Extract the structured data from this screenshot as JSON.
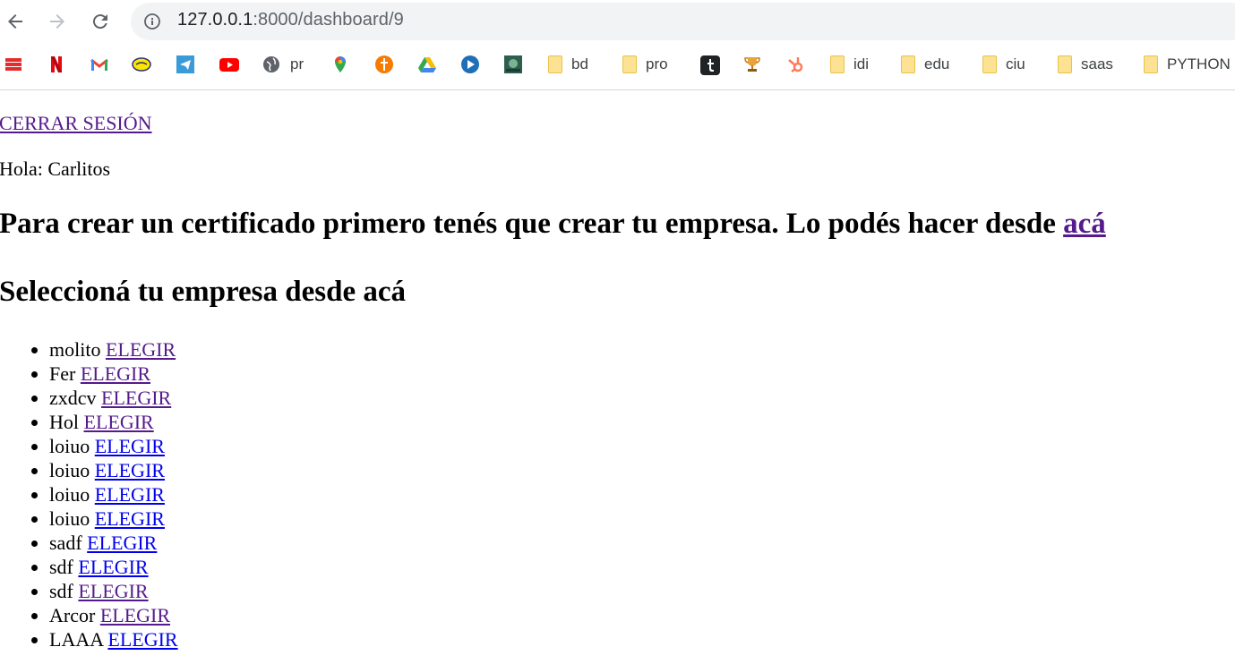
{
  "browser": {
    "url_host": "127.0.0.1",
    "url_path": ":8000/dashboard/9",
    "bookmarks": [
      {
        "icon": "espn-icon",
        "label": ""
      },
      {
        "icon": "netflix-icon",
        "label": ""
      },
      {
        "icon": "gmail-icon",
        "label": ""
      },
      {
        "icon": "mercadolibre-icon",
        "label": ""
      },
      {
        "icon": "telegram-icon",
        "label": ""
      },
      {
        "icon": "youtube-icon",
        "label": ""
      },
      {
        "icon": "globe-icon",
        "label": "pr"
      },
      {
        "icon": "maps-icon",
        "label": ""
      },
      {
        "icon": "cross-icon",
        "label": ""
      },
      {
        "icon": "drive-icon",
        "label": ""
      },
      {
        "icon": "play-icon",
        "label": ""
      },
      {
        "icon": "image-icon",
        "label": ""
      },
      {
        "icon": "folder-icon",
        "label": "bd"
      },
      {
        "icon": "folder-icon",
        "label": "pro"
      },
      {
        "icon": "tumblr-icon",
        "label": ""
      },
      {
        "icon": "trophy-icon",
        "label": ""
      },
      {
        "icon": "hubspot-icon",
        "label": ""
      },
      {
        "icon": "folder-icon",
        "label": "idi"
      },
      {
        "icon": "folder-icon",
        "label": "edu"
      },
      {
        "icon": "folder-icon",
        "label": "ciu"
      },
      {
        "icon": "folder-icon",
        "label": "saas"
      },
      {
        "icon": "folder-icon",
        "label": "PYTHON"
      }
    ]
  },
  "page": {
    "logout_label": "CERRAR SESIÓN",
    "greeting": "Hola: Carlitos",
    "create_msg": "Para crear un certificado primero tenés que crear tu empresa. Lo podés hacer desde ",
    "create_link": "acá",
    "select_heading": "Seleccioná tu empresa desde acá",
    "choose_label": "ELEGIR",
    "companies": [
      {
        "name": "molito",
        "visited": true
      },
      {
        "name": "Fer",
        "visited": true
      },
      {
        "name": "zxdcv",
        "visited": true
      },
      {
        "name": "Hol",
        "visited": true
      },
      {
        "name": "loiuo",
        "visited": false
      },
      {
        "name": "loiuo",
        "visited": false
      },
      {
        "name": "loiuo",
        "visited": false
      },
      {
        "name": "loiuo",
        "visited": false
      },
      {
        "name": "sadf",
        "visited": false
      },
      {
        "name": "sdf",
        "visited": false
      },
      {
        "name": "sdf",
        "visited": true
      },
      {
        "name": "Arcor",
        "visited": true
      },
      {
        "name": "LAAA",
        "visited": false
      }
    ]
  }
}
